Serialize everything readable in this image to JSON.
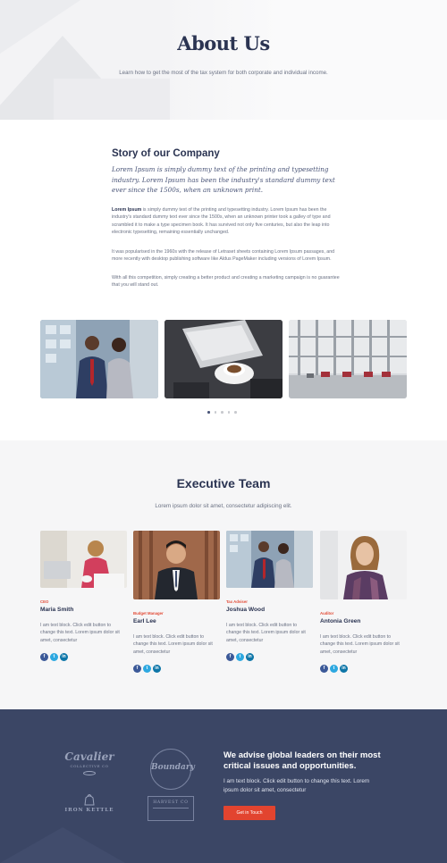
{
  "hero": {
    "title": "About Us",
    "subtitle": "Learn how to get the most of the tax system for both corporate and individual income."
  },
  "story": {
    "title": "Story of our Company",
    "intro": "Lorem Ipsum is simply dummy text of the printing and typesetting industry. Lorem Ipsum has been the industry's standard dummy text ever since the 1500s, when an unknown print.",
    "p1_bold": "Lorem Ipsum",
    "p1_rest": " is simply dummy text of the printing and typesetting industry. Lorem Ipsum has been the industry's standard dummy text ever since the 1500s, when an unknown printer took a galley of type and scrambled it to make a type specimen book. It has survived not only five centuries, but also the leap into electronic typesetting, remaining essentially unchanged.",
    "p2": "It was popularised in the 1960s with the release of Letraset sheets containing Lorem Ipsum passages, and more recently with desktop publishing software like Aldus PageMaker including versions of Lorem Ipsum.",
    "p3": "With all this competition, simply creating a better product and creating a marketing campaign is no guarantee that you will stand out."
  },
  "gallery": {
    "slides": 5,
    "active_slide": 1
  },
  "team": {
    "title": "Executive Team",
    "subtitle": "Lorem ipsum dolor sit amet, consectetur adipiscing elit.",
    "members": [
      {
        "role": "CEO",
        "name": "Maria Smith",
        "bio": "I am text block. Click edit button to change this text. Lorem ipsum dolor sit amet, consectetur"
      },
      {
        "role": "Budget Manager",
        "name": "Earl Lee",
        "bio": "I am text block. Click edit button to change this text. Lorem ipsum dolor sit amet, consectetur"
      },
      {
        "role": "Tax Adviser",
        "name": "Joshua Wood",
        "bio": "I am text block. Click edit button to change this text. Lorem ipsum dolor sit amet, consectetur"
      },
      {
        "role": "Auditor",
        "name": "Antonia Green",
        "bio": "I am text block. Click edit button to change this text. Lorem ipsum dolor sit amet, consectetur"
      }
    ],
    "social": {
      "facebook": "f",
      "twitter": "t",
      "linkedin": "in"
    }
  },
  "footer": {
    "logos": {
      "cavalier_name": "Cavalier",
      "cavalier_sub": "COLLECTIVE CO",
      "boundary_name": "Boundary",
      "iron_name": "IRON KETTLE",
      "harvest_name": "HARVEST CO"
    },
    "title": "We advise global leaders on their most critical issues and opportunities.",
    "text": "I am text block. Click edit button to change this text. Lorem ipsum dolor sit amet, consectetur",
    "button_label": "Get in Touch"
  },
  "colors": {
    "navy": "#2b3452",
    "accent": "#e24a35",
    "footer_bg": "#3b4665"
  }
}
